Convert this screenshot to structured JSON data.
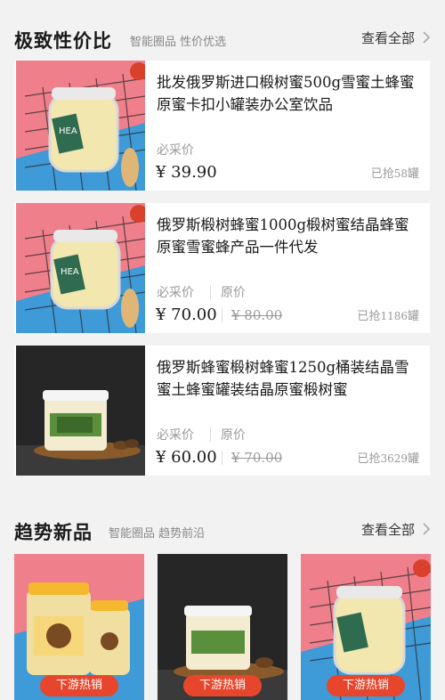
{
  "section1": {
    "title": "极致性价比",
    "subtitle": "智能圈品 性价优选",
    "see_all": "查看全部"
  },
  "products": [
    {
      "title": "批发俄罗斯进口椴树蜜500g雪蜜土蜂蜜原蜜卡扣小罐装办公室饮品",
      "price_label": "必采价",
      "price": "¥ 39.90",
      "orig_label": "",
      "orig_price": "",
      "sold_prefix": "已抢",
      "sold_count": "58",
      "sold_unit": "罐"
    },
    {
      "title": "俄罗斯椴树蜂蜜1000g椴树蜜结晶蜂蜜原蜜雪蜜蜂产品一件代发",
      "price_label": "必采价",
      "price": "¥ 70.00",
      "orig_label": "原价",
      "orig_price": "¥ 80.00",
      "sold_prefix": "已抢",
      "sold_count": "1186",
      "sold_unit": "罐"
    },
    {
      "title": "俄罗斯蜂蜜椴树蜂蜜1250g桶装结晶雪蜜土蜂蜜罐装结晶原蜜椴树蜜",
      "price_label": "必采价",
      "price": "¥ 60.00",
      "orig_label": "原价",
      "orig_price": "¥ 70.00",
      "sold_prefix": "已抢",
      "sold_count": "3629",
      "sold_unit": "罐"
    }
  ],
  "section2": {
    "title": "趋势新品",
    "subtitle": "智能圈品 趋势前沿",
    "see_all": "查看全部"
  },
  "tiles": [
    {
      "tag": "下游热销"
    },
    {
      "tag": "下游热销"
    },
    {
      "tag": "下游热销"
    }
  ],
  "images": {
    "jar_label": "HEA"
  },
  "colors": {
    "accent_red": "#e8462c",
    "pink_bg": "#f07f8c",
    "blue_bg": "#3f9ad8",
    "honey": "#f3e7b0"
  },
  "icons": {
    "chevron": "chevron-right-icon",
    "jar": "honey-jar-photo"
  }
}
